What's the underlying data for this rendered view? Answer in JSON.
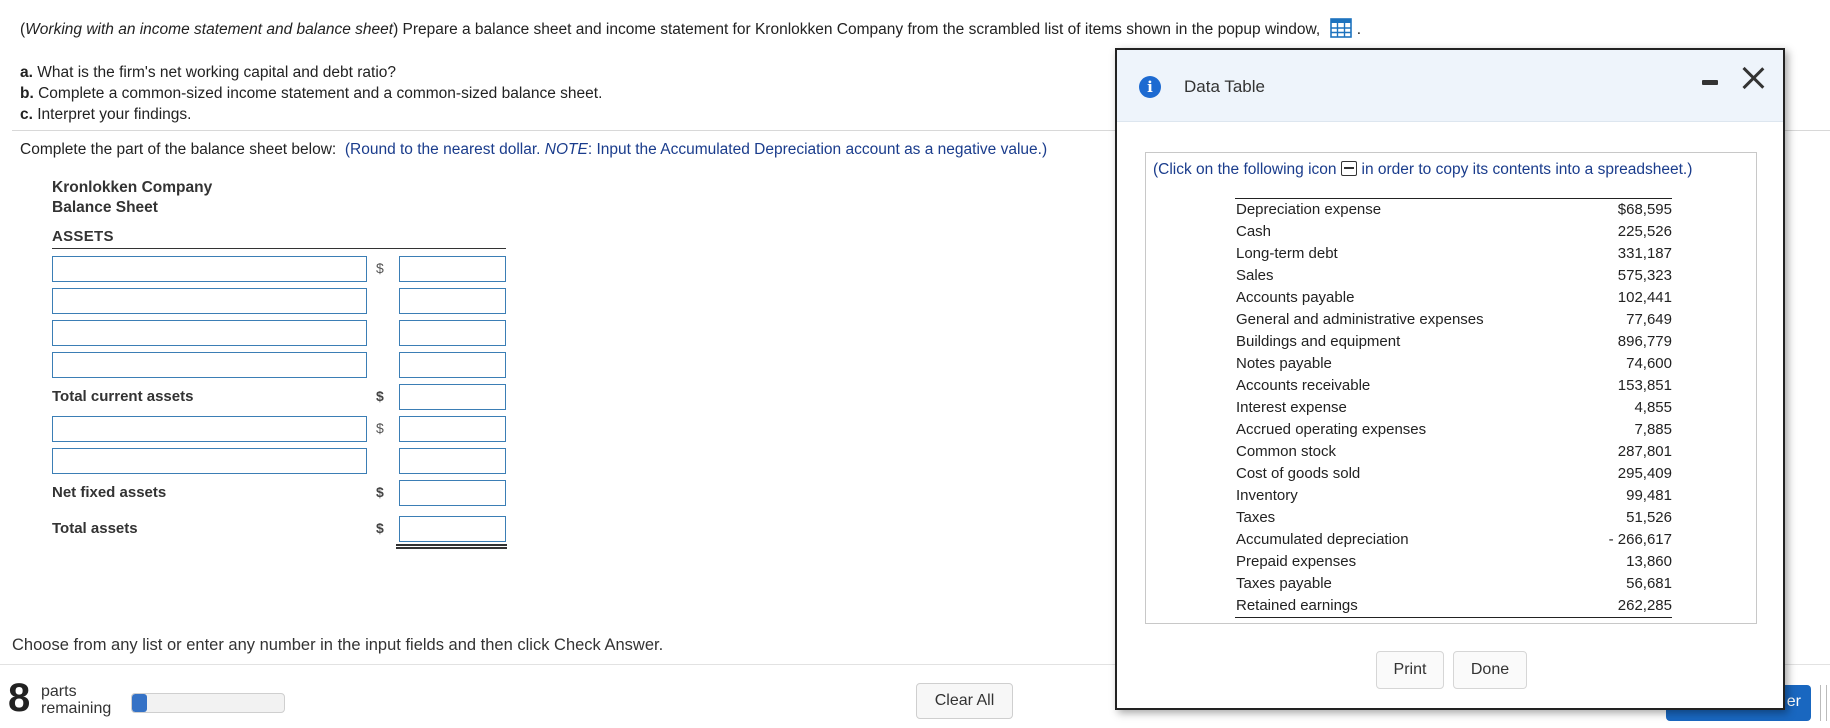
{
  "question": {
    "intro_italic": "Working with an income statement and balance sheet",
    "intro_rest": "Prepare a balance sheet and income statement for Kronlokken Company from the scrambled list of items shown in the popup window,",
    "icon": "grid-table-icon",
    "parts": [
      {
        "letter": "a.",
        "text": "What is the firm's net working capital and debt ratio?"
      },
      {
        "letter": "b.",
        "text": "Complete a common-sized income statement and a common-sized balance sheet."
      },
      {
        "letter": "c.",
        "text": "Interpret your findings."
      }
    ]
  },
  "instruction": {
    "lead": "Complete the part of the balance sheet below:",
    "round": "(Round to the nearest dollar.",
    "note_label": "NOTE",
    "note_text": ": Input the Accumulated Depreciation  account as a negative value.)"
  },
  "balance_sheet": {
    "company": "Kronlokken Company",
    "title": "Balance Sheet",
    "section": "ASSETS",
    "currency_symbol": "$",
    "total_current_assets": "Total current assets",
    "net_fixed_assets": "Net fixed assets",
    "total_assets": "Total assets"
  },
  "footer": {
    "choose_text": "Choose from any list or enter any number in the input fields and then click Check Answer.",
    "parts_count": "8",
    "parts_word1": "parts",
    "parts_word2": "remaining",
    "progress_fraction": 0.1,
    "clear_all": "Clear All",
    "check_answer_visible": "er"
  },
  "popup": {
    "title": "Data Table",
    "note_before": "(Click on the following icon",
    "note_after": "in order to copy its contents into a spreadsheet.)",
    "rows": [
      {
        "name": "Depreciation expense",
        "value": "$68,595"
      },
      {
        "name": "Cash",
        "value": "225,526"
      },
      {
        "name": "Long-term debt",
        "value": "331,187"
      },
      {
        "name": "Sales",
        "value": "575,323"
      },
      {
        "name": "Accounts payable",
        "value": "102,441"
      },
      {
        "name": "General and administrative expenses",
        "value": "77,649"
      },
      {
        "name": "Buildings and equipment",
        "value": "896,779"
      },
      {
        "name": "Notes payable",
        "value": "74,600"
      },
      {
        "name": "Accounts receivable",
        "value": "153,851"
      },
      {
        "name": "Interest expense",
        "value": "4,855"
      },
      {
        "name": "Accrued operating expenses",
        "value": "7,885"
      },
      {
        "name": "Common stock",
        "value": "287,801"
      },
      {
        "name": "Cost of goods sold",
        "value": "295,409"
      },
      {
        "name": "Inventory",
        "value": "99,481"
      },
      {
        "name": "Taxes",
        "value": "51,526"
      },
      {
        "name": "Accumulated depreciation",
        "value": "- 266,617"
      },
      {
        "name": "Prepaid expenses",
        "value": "13,860"
      },
      {
        "name": "Taxes payable",
        "value": "56,681"
      },
      {
        "name": "Retained earnings",
        "value": "262,285"
      }
    ],
    "print_label": "Print",
    "done_label": "Done"
  },
  "colors": {
    "accent_blue": "#1a3c8c",
    "input_border": "#3b7eb5",
    "button_primary": "#1967c0",
    "info_icon": "#1d6ad1"
  }
}
